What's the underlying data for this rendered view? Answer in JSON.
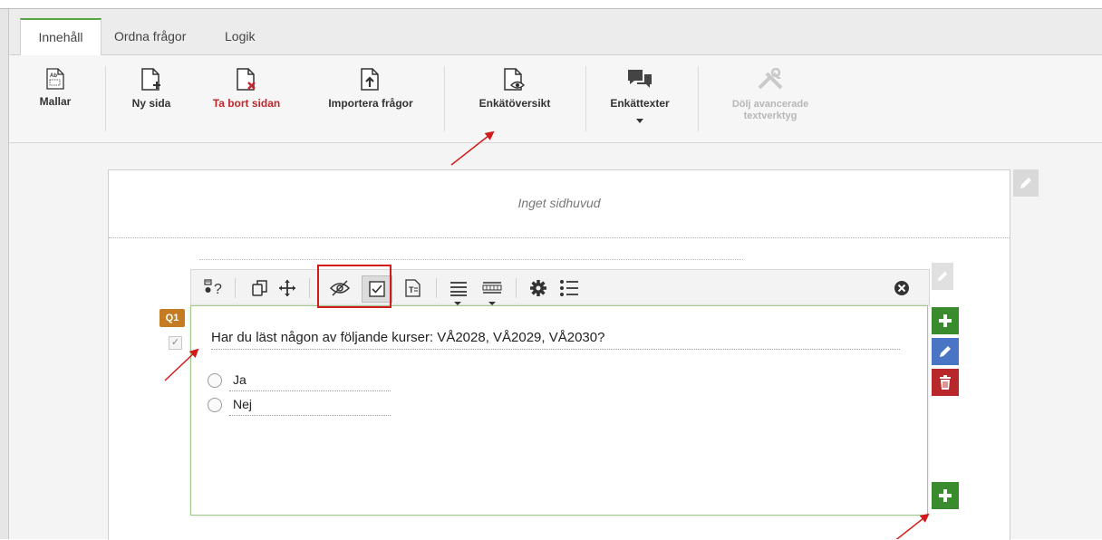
{
  "tabs": [
    {
      "label": "Innehåll",
      "active": true
    },
    {
      "label": "Ordna frågor",
      "active": false
    },
    {
      "label": "Logik",
      "active": false
    }
  ],
  "ribbon": {
    "mallar": "Mallar",
    "ny_sida": "Ny sida",
    "ta_bort_sidan": "Ta bort sidan",
    "importera_fragor": "Importera frågor",
    "enkatoversikt": "Enkätöversikt",
    "enkattexter": "Enkättexter",
    "dolj_line1": "Dölj avancerade",
    "dolj_line2": "textverktyg"
  },
  "page": {
    "header_placeholder": "Inget sidhuvud"
  },
  "question": {
    "number_badge": "Q1",
    "title": "Har du läst någon av följande kurser: VÅ2028, VÅ2029, VÅ2030?",
    "options": [
      "Ja",
      "Nej"
    ]
  },
  "toolbar_icons": [
    "question-type-icon",
    "copy-icon",
    "move-icon",
    "hide-icon",
    "required-checkbox-icon",
    "text-format-icon",
    "align-list-icon",
    "columns-icon",
    "settings-icon",
    "list-icon",
    "close-circle-icon"
  ],
  "colors": {
    "accent_green": "#3a8a2e",
    "edit_blue": "#4a74c4",
    "delete_red": "#b8282a",
    "badge_orange": "#c57b22",
    "annotation_red": "#d11a1a"
  }
}
